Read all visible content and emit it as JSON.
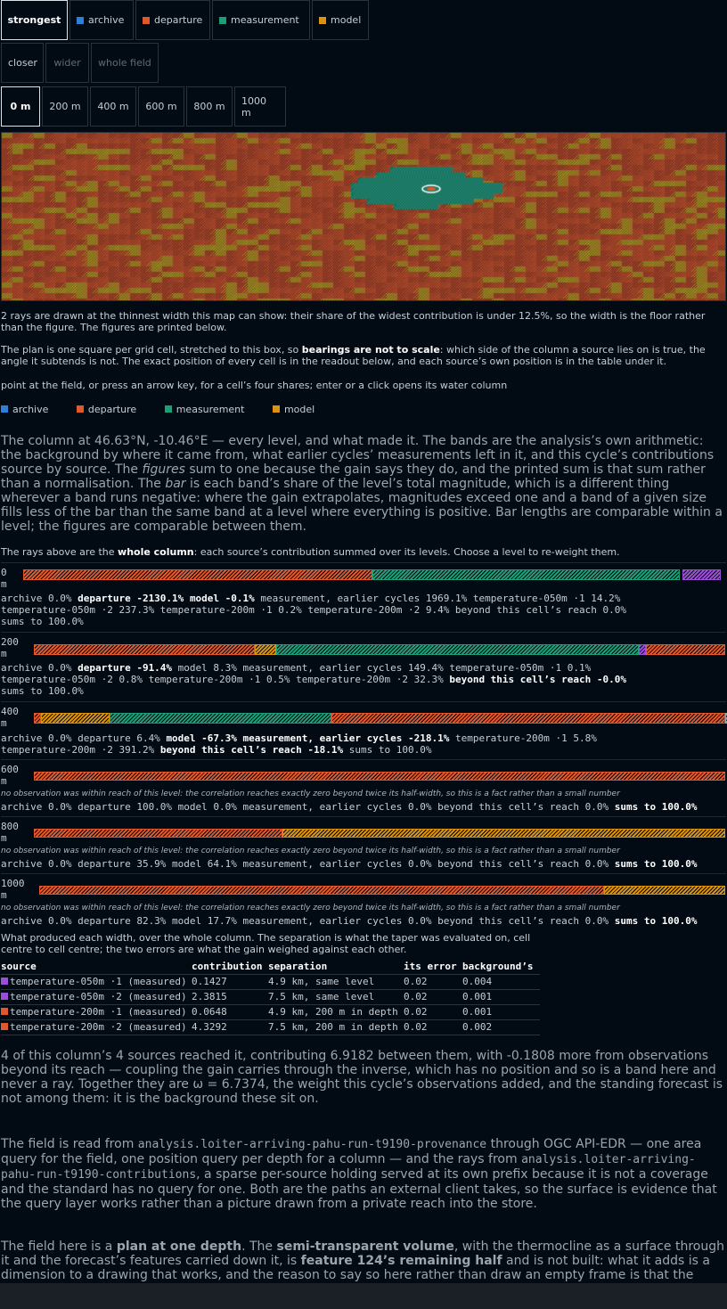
{
  "filters": {
    "items": [
      {
        "label": "strongest",
        "color": null,
        "selected": true
      },
      {
        "label": "archive",
        "color": "#2f7fd6"
      },
      {
        "label": "departure",
        "color": "#e0582b"
      },
      {
        "label": "measurement",
        "color": "#1d9e78"
      },
      {
        "label": "model",
        "color": "#d9930e"
      }
    ]
  },
  "zoom": {
    "closer": "closer",
    "wider": "wider",
    "whole_field": "whole field"
  },
  "depths": [
    "0 m",
    "200 m",
    "400 m",
    "600 m",
    "800 m",
    "1000 m"
  ],
  "selected_depth": "0 m",
  "map": {
    "description_text": ""
  },
  "texts": {
    "rays_note": "2 rays are drawn at the thinnest width this map can show: their share of the widest contribution is under 12.5%, so the width is the floor rather than the figure. The figures are printed below.",
    "plan_pre": "The plan is one square per grid cell, stretched to this box, so ",
    "plan_bold": "bearings are not to scale",
    "plan_post": ": which side of the column a source lies on is true, the angle it subtends is not. The exact position of every cell is in the readout below, and each source’s own position is in the table under it.",
    "hint": "point at the field, or press an arrow key, for a cell’s four shares; enter or a click opens its water column",
    "column_p1": "The column at 46.63°N, -10.46°E — every level, and what made it. The bands are the analysis’s own arithmetic: the background by where it came from, what earlier cycles’ measurements left in it, and this cycle’s contributions source by source. The ",
    "column_figures": "figures",
    "column_p2": " sum to one because the gain says they do, and the printed sum is that sum rather than a normalisation. The ",
    "column_bar": "bar",
    "column_p3": " is each band’s share of the level’s total magnitude, which is a different thing wherever a band runs negative: where the gain extrapolates, magnitudes exceed one and a band of a given size fills less of the bar than the same band at a level where everything is positive. Bar lengths are comparable within a level; the figures are comparable between them.",
    "rays_above_pre": "The rays above are the ",
    "rays_above_bold": "whole column",
    "rays_above_post": ": each source’s contribution summed over its levels. Choose a level to re-weight them.",
    "table_caption": "What produced each width, over the whole column. The separation is what the taper was evaluated on, cell centre to cell centre; the two errors are what the gain weighed against each other.",
    "summary": "4 of this column’s 4 sources reached it, contributing 6.9182 between them, with -0.1808 more from observations beyond its reach — coupling the gain carries through the inverse, which has no position and so is a band here and never a ray. Together they are ω = 6.7374, the weight this cycle’s observations added, and the standing forecast is not among them: it is the background these sit on.",
    "field_p1": "The field is read from ",
    "field_code1": "analysis.loiter-arriving-pahu-run-t9190-provenance",
    "field_p2": " through OGC API-EDR — one area query for the field, one position query per depth for a column — and the rays from ",
    "field_code2": "analysis.loiter-arriving-pahu-run-t9190-contributions",
    "field_p3": ", a sparse per-source holding served at its own prefix because it is not a coverage and the standard has no query for one. Both are the paths an external client takes, so the surface is evidence that the query layer works rather than a picture drawn from a private reach into the store.",
    "plan_depth_p1": "The field here is a ",
    "plan_depth_b1": "plan at one depth",
    "plan_depth_p2": ". The ",
    "plan_depth_b2": "semi-transparent volume",
    "plan_depth_p3": ", with the thermocline as a surface through it and the forecast’s features carried down it, is ",
    "plan_depth_b3": "feature 124’s remaining half",
    "plan_depth_p4": " and is not built: what it adds is a dimension to a drawing that works, and the reason to say so here rather than draw an empty frame is that the"
  },
  "levels": [
    {
      "depth": "0\nm",
      "note": "",
      "line1": [
        "archive 0.0% ",
        "departure -2130.1%",
        " ",
        "model -0.1%",
        " measurement, earlier cycles 1969.1% temperature-050m ·1 14.2%"
      ],
      "line2": "temperature-050m ·2 237.3% temperature-200m ·1 0.2% temperature-200m ·2 9.4% beyond this cell’s reach 0.0%",
      "line3": "sums to 100.0%",
      "segments": [
        {
          "kind": "departure",
          "share": 0.5
        },
        {
          "kind": "measurement",
          "share": 0.44
        },
        {
          "kind": "gap",
          "share": 0.004
        },
        {
          "kind": "purple",
          "share": 0.055
        }
      ]
    },
    {
      "depth": "200\nm",
      "note": "",
      "line1": [
        "archive 0.0% ",
        "departure -91.4%",
        " model 8.3% measurement, earlier cycles 149.4% temperature-050m ·1 0.1%",
        "",
        ""
      ],
      "line2": "temperature-050m ·2 0.8% temperature-200m ·1 0.5% temperature-200m ·2 32.3% ",
      "line2_bold": "beyond this cell’s reach -0.0%",
      "line3": "sums to 100.0%",
      "segments": [
        {
          "kind": "departure",
          "share": 0.32
        },
        {
          "kind": "model",
          "share": 0.03
        },
        {
          "kind": "measurement",
          "share": 0.525
        },
        {
          "kind": "purple",
          "share": 0.01
        },
        {
          "kind": "departure",
          "share": 0.115
        }
      ]
    },
    {
      "depth": "400\nm",
      "note": "",
      "line1": [
        "archive 0.0% departure 6.4% ",
        "model -67.3% measurement, earlier cycles -218.1%",
        " temperature-200m ·1 5.8%",
        "",
        ""
      ],
      "line2": "temperature-200m ·2 391.2% ",
      "line2_bold": "beyond this cell’s reach -18.1%",
      "line2_post": " sums to 100.0%",
      "segments": [
        {
          "kind": "departure",
          "share": 0.01
        },
        {
          "kind": "model",
          "share": 0.1
        },
        {
          "kind": "measurement",
          "share": 0.32
        },
        {
          "kind": "departure",
          "share": 0.57
        },
        {
          "kind": "grey",
          "share": 0.025
        }
      ]
    },
    {
      "depth": "600\nm",
      "note": "no observation was within reach of this level: the correlation reaches exactly zero beyond twice its half-width, so this is a fact rather than a small number",
      "line1": [
        "archive 0.0% departure 100.0% model 0.0% measurement, earlier cycles 0.0% beyond this cell’s reach 0.0% ",
        "sums to 100.0%",
        "",
        "",
        ""
      ],
      "segments": [
        {
          "kind": "departure",
          "share": 1.0
        }
      ]
    },
    {
      "depth": "800\nm",
      "note": "no observation was within reach of this level: the correlation reaches exactly zero beyond twice its half-width, so this is a fact rather than a small number",
      "line1": [
        "archive 0.0% departure 35.9% model 64.1% measurement, earlier cycles 0.0% beyond this cell’s reach 0.0% ",
        "sums to 100.0%",
        "",
        "",
        ""
      ],
      "segments": [
        {
          "kind": "departure",
          "share": 0.359
        },
        {
          "kind": "model",
          "share": 0.641
        }
      ]
    },
    {
      "depth": "1000\nm",
      "note": "no observation was within reach of this level: the correlation reaches exactly zero beyond twice its half-width, so this is a fact rather than a small number",
      "line1": [
        "archive 0.0% departure 82.3% model 17.7% measurement, earlier cycles 0.0% beyond this cell’s reach 0.0% ",
        "sums to 100.0%",
        "",
        "",
        ""
      ],
      "segments": [
        {
          "kind": "departure",
          "share": 0.823
        },
        {
          "kind": "model",
          "share": 0.177
        }
      ]
    }
  ],
  "table": {
    "headers": [
      "source",
      "contribution",
      "separation",
      "its error",
      "background’s"
    ],
    "rows": [
      {
        "color": "#9b4fd6",
        "source": "temperature-050m ·1 (measured)",
        "contribution": "0.1427",
        "separation": "4.9 km, same level",
        "error": "0.02",
        "background": "0.004"
      },
      {
        "color": "#9b4fd6",
        "source": "temperature-050m ·2 (measured)",
        "contribution": "2.3815",
        "separation": "7.5 km, same level",
        "error": "0.02",
        "background": "0.001"
      },
      {
        "color": "#e0582b",
        "source": "temperature-200m ·1 (measured)",
        "contribution": "0.0648",
        "separation": "4.9 km, 200 m in depth",
        "error": "0.02",
        "background": "0.001"
      },
      {
        "color": "#e0582b",
        "source": "temperature-200m ·2 (measured)",
        "contribution": "4.3292",
        "separation": "7.5 km, 200 m in depth",
        "error": "0.02",
        "background": "0.002"
      }
    ]
  },
  "colors": {
    "archive": "#2f7fd6",
    "departure": "#e0582b",
    "measurement": "#1d9e78",
    "model": "#d9930e",
    "purple": "#9b4fd6",
    "grey": "#9aa0a6"
  }
}
